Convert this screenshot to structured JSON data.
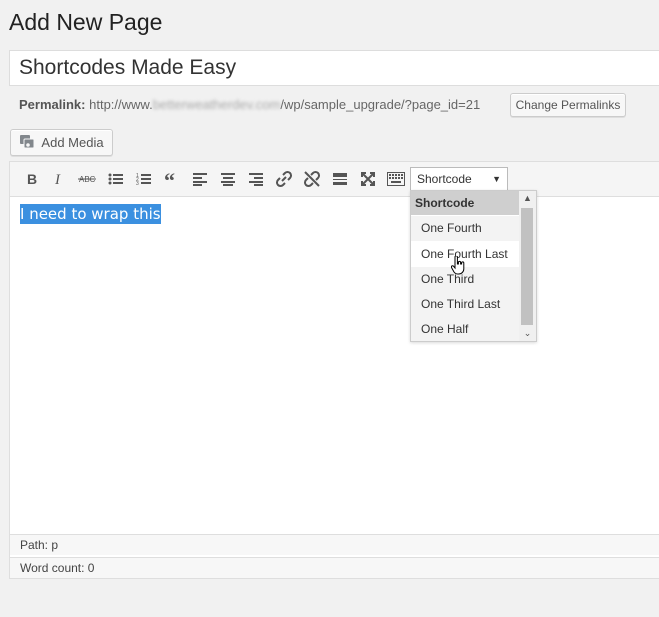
{
  "page": {
    "title": "Add New Page",
    "post_title": "Shortcodes Made Easy"
  },
  "permalink": {
    "label": "Permalink:",
    "url_prefix": "http://www.",
    "url_blurred": "betterweatherdev.com",
    "url_suffix": "/wp/sample_upgrade/?page_id=21",
    "change_button": "Change Permalinks"
  },
  "media": {
    "add_button": "Add Media"
  },
  "toolbar": {
    "buttons": [
      "bold-icon",
      "italic-icon",
      "strikethrough-icon",
      "bullet-list-icon",
      "numbered-list-icon",
      "blockquote-icon",
      "align-left-icon",
      "align-center-icon",
      "align-right-icon",
      "link-icon",
      "unlink-icon",
      "more-tag-icon",
      "fullscreen-icon",
      "kitchen-sink-icon"
    ],
    "shortcode_select": "Shortcode"
  },
  "dropdown": {
    "header": "Shortcode",
    "items": [
      "One Fourth",
      "One Fourth Last",
      "One Third",
      "One Third Last",
      "One Half"
    ],
    "hovered": "One Fourth Last"
  },
  "editor": {
    "content_selected": "I need to wrap this",
    "path": "Path: p",
    "word_count": "Word count: 0"
  },
  "colors": {
    "selection": "#3b90e0",
    "background": "#f1f1f1"
  }
}
